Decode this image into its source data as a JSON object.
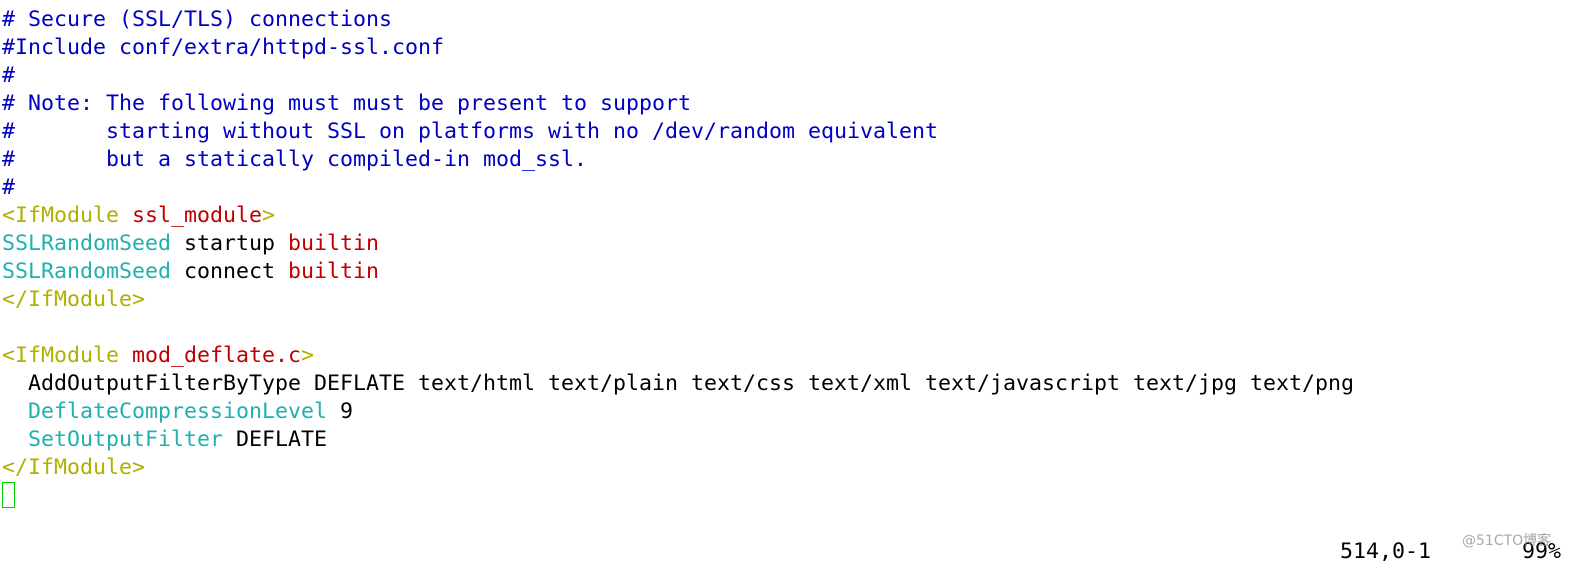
{
  "editor": {
    "lines": [
      [
        {
          "text": "# Secure (SSL/TLS) connections",
          "kind": "comment"
        }
      ],
      [
        {
          "text": "#Include conf/extra/httpd-ssl.conf",
          "kind": "comment"
        }
      ],
      [
        {
          "text": "#",
          "kind": "comment"
        }
      ],
      [
        {
          "text": "# Note: The following must must be present to support",
          "kind": "comment"
        }
      ],
      [
        {
          "text": "#       starting without SSL on platforms with no /dev/random equivalent",
          "kind": "comment"
        }
      ],
      [
        {
          "text": "#       but a statically compiled-in mod_ssl.",
          "kind": "comment"
        }
      ],
      [
        {
          "text": "#",
          "kind": "comment"
        }
      ],
      [
        {
          "text": "<IfModule ",
          "kind": "tag"
        },
        {
          "text": "ssl_module",
          "kind": "arg"
        },
        {
          "text": ">",
          "kind": "tag"
        }
      ],
      [
        {
          "text": "SSLRandomSeed",
          "kind": "directive"
        },
        {
          "text": " startup ",
          "kind": "plain"
        },
        {
          "text": "builtin",
          "kind": "arg"
        }
      ],
      [
        {
          "text": "SSLRandomSeed",
          "kind": "directive"
        },
        {
          "text": " connect ",
          "kind": "plain"
        },
        {
          "text": "builtin",
          "kind": "arg"
        }
      ],
      [
        {
          "text": "</IfModule>",
          "kind": "tag"
        }
      ],
      [],
      [
        {
          "text": "<IfModule ",
          "kind": "tag"
        },
        {
          "text": "mod_deflate.c",
          "kind": "arg"
        },
        {
          "text": ">",
          "kind": "tag"
        }
      ],
      [
        {
          "text": "  AddOutputFilterByType DEFLATE text/html text/plain text/css text/xml text/javascript text/jpg text/png",
          "kind": "plain"
        }
      ],
      [
        {
          "text": "  ",
          "kind": "plain"
        },
        {
          "text": "DeflateCompressionLevel",
          "kind": "directive"
        },
        {
          "text": " 9",
          "kind": "plain"
        }
      ],
      [
        {
          "text": "  ",
          "kind": "plain"
        },
        {
          "text": "SetOutputFilter",
          "kind": "directive"
        },
        {
          "text": " DEFLATE",
          "kind": "plain"
        }
      ],
      [
        {
          "text": "</IfModule>",
          "kind": "tag"
        }
      ]
    ]
  },
  "status": {
    "position": "514,0-1",
    "percent": "99%"
  },
  "watermark": "@51CTO博客",
  "colors": {
    "comment": "#0000c0",
    "tag": "#b0b000",
    "arg": "#c00000",
    "directive": "#1fb0b0",
    "cursor": "#00d000"
  }
}
